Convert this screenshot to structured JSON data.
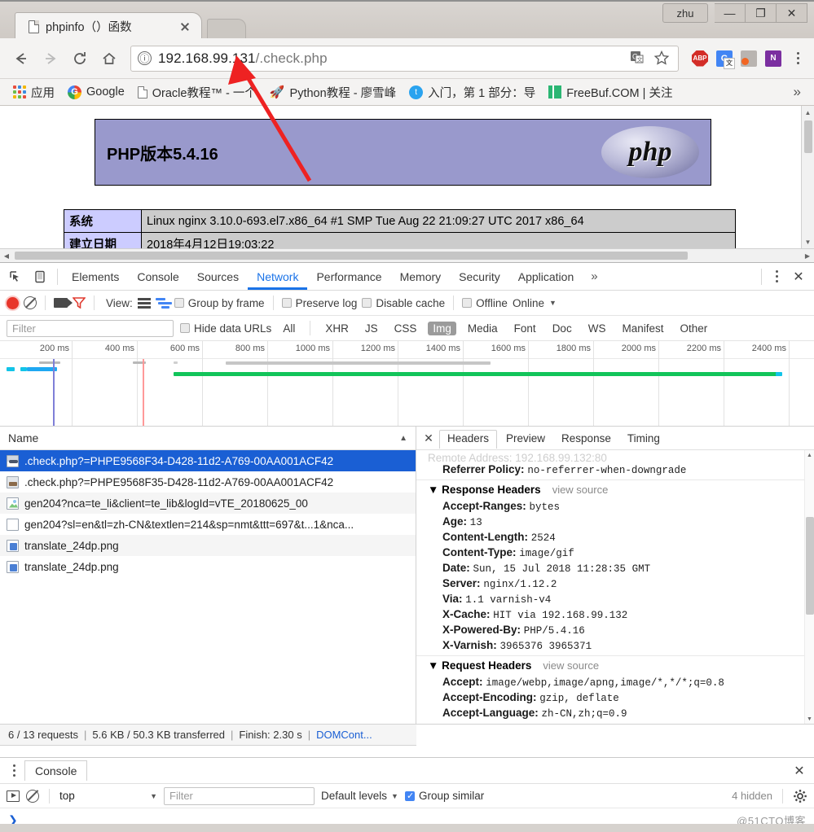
{
  "window": {
    "profile_label": "zhu",
    "minimize": "—",
    "maximize": "❐",
    "close": "✕"
  },
  "tab": {
    "title": "phpinfo（）函数",
    "close_label": ""
  },
  "omnibox": {
    "url_host": "192.168.99.131",
    "url_path": "/.check.php",
    "info_glyph": "ⓘ"
  },
  "bookmarks": [
    {
      "label": "应用",
      "icon": "apps-grid-icon"
    },
    {
      "label": "Google",
      "icon": "google-logo-icon"
    },
    {
      "label": "Oracle教程™ - 一个",
      "icon": "document-icon"
    },
    {
      "label": "Python教程 - 廖雪峰",
      "icon": "rocket-icon"
    },
    {
      "label": "入门，第 1 部分：导",
      "icon": "twitter-icon"
    },
    {
      "label": "FreeBuf.COM | 关注",
      "icon": "freebuf-icon"
    }
  ],
  "bookmarks_overflow": "»",
  "page": {
    "php_version_title": "PHP版本5.4.16",
    "php_logo_text": "php",
    "table": [
      {
        "key": "系统",
        "value": "Linux nginx 3.10.0-693.el7.x86_64 #1 SMP Tue Aug 22 21:09:27 UTC 2017 x86_64"
      },
      {
        "key": "建立日期",
        "value": "2018年4月12日19:03:22"
      }
    ]
  },
  "devtools": {
    "tabs": [
      {
        "label": "Elements",
        "active": false
      },
      {
        "label": "Console",
        "active": false
      },
      {
        "label": "Sources",
        "active": false
      },
      {
        "label": "Network",
        "active": true
      },
      {
        "label": "Performance",
        "active": false
      },
      {
        "label": "Memory",
        "active": false
      },
      {
        "label": "Security",
        "active": false
      },
      {
        "label": "Application",
        "active": false
      }
    ],
    "tabs_overflow": "»",
    "close_label": "✕",
    "toolbar": {
      "view_label": "View:",
      "group_by_frame": "Group by frame",
      "preserve_log": "Preserve log",
      "disable_cache": "Disable cache",
      "offline": "Offline",
      "online": "Online",
      "throttle_caret": "▼"
    },
    "filterbar": {
      "filter_placeholder": "Filter",
      "filter_value": "",
      "hide_data_urls": "Hide data URLs",
      "types": [
        {
          "label": "All",
          "active": false
        },
        {
          "label": "XHR",
          "active": false
        },
        {
          "label": "JS",
          "active": false
        },
        {
          "label": "CSS",
          "active": false
        },
        {
          "label": "Img",
          "active": true
        },
        {
          "label": "Media",
          "active": false
        },
        {
          "label": "Font",
          "active": false
        },
        {
          "label": "Doc",
          "active": false
        },
        {
          "label": "WS",
          "active": false
        },
        {
          "label": "Manifest",
          "active": false
        },
        {
          "label": "Other",
          "active": false
        }
      ]
    },
    "timeline": {
      "ticks": [
        "200 ms",
        "400 ms",
        "600 ms",
        "800 ms",
        "1000 ms",
        "1200 ms",
        "1400 ms",
        "1600 ms",
        "1800 ms",
        "2000 ms",
        "2200 ms",
        "2400 ms"
      ]
    },
    "requests": {
      "column_name": "Name",
      "sort_glyph": "▲",
      "rows": [
        {
          "name": ".check.php?=PHPE9568F34-D428-11d2-A769-00AA001ACF42",
          "icon": "image-file-icon",
          "selected": true
        },
        {
          "name": ".check.php?=PHPE9568F35-D428-11d2-A769-00AA001ACF42",
          "icon": "image-file-icon",
          "selected": false
        },
        {
          "name": "gen204?nca=te_li&client=te_lib&logId=vTE_20180625_00",
          "icon": "image-document-icon",
          "selected": false
        },
        {
          "name": "gen204?sl=en&tl=zh-CN&textlen=214&sp=nmt&ttt=697&t...1&nca...",
          "icon": "blank-document-icon",
          "selected": false
        },
        {
          "name": "translate_24dp.png",
          "icon": "png-file-icon",
          "selected": false
        },
        {
          "name": "translate_24dp.png",
          "icon": "png-file-icon",
          "selected": false
        }
      ]
    },
    "details": {
      "close_label": "✕",
      "tabs": [
        {
          "label": "Headers",
          "active": true
        },
        {
          "label": "Preview",
          "active": false
        },
        {
          "label": "Response",
          "active": false
        },
        {
          "label": "Timing",
          "active": false
        }
      ],
      "clipped_row": "Remote Address: 192.168.99.132:80",
      "referrer_policy": {
        "key": "Referrer Policy:",
        "value": "no-referrer-when-downgrade"
      },
      "response_headers_title": "Response Headers",
      "request_headers_title": "Request Headers",
      "view_source": "view source",
      "response_headers": [
        {
          "key": "Accept-Ranges:",
          "value": "bytes"
        },
        {
          "key": "Age:",
          "value": "13"
        },
        {
          "key": "Content-Length:",
          "value": "2524"
        },
        {
          "key": "Content-Type:",
          "value": "image/gif"
        },
        {
          "key": "Date:",
          "value": "Sun, 15 Jul 2018 11:28:35 GMT"
        },
        {
          "key": "Server:",
          "value": "nginx/1.12.2"
        },
        {
          "key": "Via:",
          "value": "1.1 varnish-v4"
        },
        {
          "key": "X-Cache:",
          "value": "HIT via 192.168.99.132"
        },
        {
          "key": "X-Powered-By:",
          "value": "PHP/5.4.16"
        },
        {
          "key": "X-Varnish:",
          "value": "3965376 3965371"
        }
      ],
      "request_headers": [
        {
          "key": "Accept:",
          "value": "image/webp,image/apng,image/*,*/*;q=0.8"
        },
        {
          "key": "Accept-Encoding:",
          "value": "gzip, deflate"
        },
        {
          "key": "Accept-Language:",
          "value": "zh-CN,zh;q=0.9"
        }
      ]
    },
    "status": {
      "requests": "6 / 13 requests",
      "transferred": "5.6 KB / 50.3 KB transferred",
      "finish": "Finish: 2.30 s",
      "domcontent": "DOMCont...",
      "separator": "|"
    }
  },
  "drawer": {
    "tab_label": "Console",
    "close_label": "✕",
    "context": "top",
    "context_caret": "▼",
    "filter_placeholder": "Filter",
    "levels_label": "Default levels",
    "levels_caret": "▼",
    "group_similar": "Group similar",
    "hidden_count": "4 hidden",
    "prompt": "❯",
    "watermark": "@51CTO博客"
  }
}
